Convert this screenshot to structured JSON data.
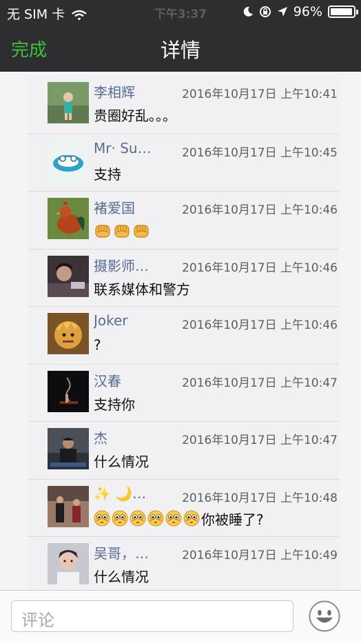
{
  "status_bar": {
    "carrier": "无 SIM 卡",
    "time": "下午3:37",
    "battery": "96%",
    "battery_level": 0.96
  },
  "nav": {
    "done_label": "完成",
    "title": "详情",
    "done_color": "#3fbf3f"
  },
  "comments": [
    {
      "name": "李相辉",
      "time": "2016年10月17日 上午10:41",
      "text": "贵圈好乱。。。"
    },
    {
      "name": "Mr· Su…",
      "time": "2016年10月17日 上午10:45",
      "text": "支持"
    },
    {
      "name": "褚爱国",
      "time": "2016年10月17日 上午10:46",
      "emoji": [
        "fist-emoji",
        "fist-emoji",
        "fist-emoji"
      ],
      "text": ""
    },
    {
      "name": "摄影师…",
      "time": "2016年10月17日 上午10:46",
      "text": "联系媒体和警方"
    },
    {
      "name": "Joker",
      "time": "2016年10月17日 上午10:46",
      "text": "?"
    },
    {
      "name": "汉春",
      "time": "2016年10月17日 上午10:47",
      "text": "支持你"
    },
    {
      "name": "杰",
      "time": "2016年10月17日 上午10:47",
      "text": "什么情况"
    },
    {
      "name": "✨ 🌙…",
      "time": "2016年10月17日 上午10:48",
      "emoji": [
        "flushed-emoji",
        "flushed-emoji",
        "flushed-emoji",
        "flushed-emoji",
        "flushed-emoji",
        "flushed-emoji"
      ],
      "text": "你被睡了?"
    },
    {
      "name": "吴哥，…",
      "time": "2016年10月17日 上午10:49",
      "text": "什么情况"
    }
  ],
  "input": {
    "placeholder": "评论"
  },
  "colors": {
    "name_link": "#576b95",
    "nav_bg": "#2e2e30"
  },
  "icons": {
    "wifi": "wifi-icon",
    "moon": "moon-icon",
    "rotation_lock": "rotation-lock-icon",
    "location": "location-arrow-icon",
    "battery": "battery-icon",
    "emoji_button": "smiley-icon"
  }
}
